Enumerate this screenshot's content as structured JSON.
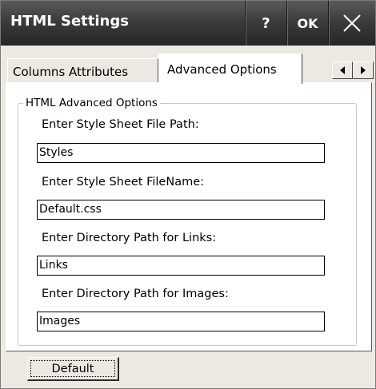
{
  "window": {
    "title": "HTML Settings",
    "help_label": "?",
    "ok_label": "OK",
    "close_icon": "close-icon"
  },
  "tabs": [
    {
      "label": "Columns Attributes",
      "active": false
    },
    {
      "label": "Advanced Options",
      "active": true
    }
  ],
  "tab_scroll": {
    "left_icon": "arrow-left-icon",
    "right_icon": "arrow-right-icon"
  },
  "group": {
    "legend": "HTML Advanced Options",
    "fields": [
      {
        "label": "Enter Style Sheet File Path:",
        "value": "Styles"
      },
      {
        "label": "Enter Style Sheet FileName:",
        "value": "Default.css"
      },
      {
        "label": "Enter Directory Path for Links:",
        "value": "Links"
      },
      {
        "label": "Enter Directory Path for Images:",
        "value": "Images"
      }
    ]
  },
  "buttons": {
    "default_label": "Default"
  },
  "colors": {
    "titlebar": "#2f2f2f",
    "window_bg": "#ece9e2",
    "panel_bg": "#ffffff"
  }
}
